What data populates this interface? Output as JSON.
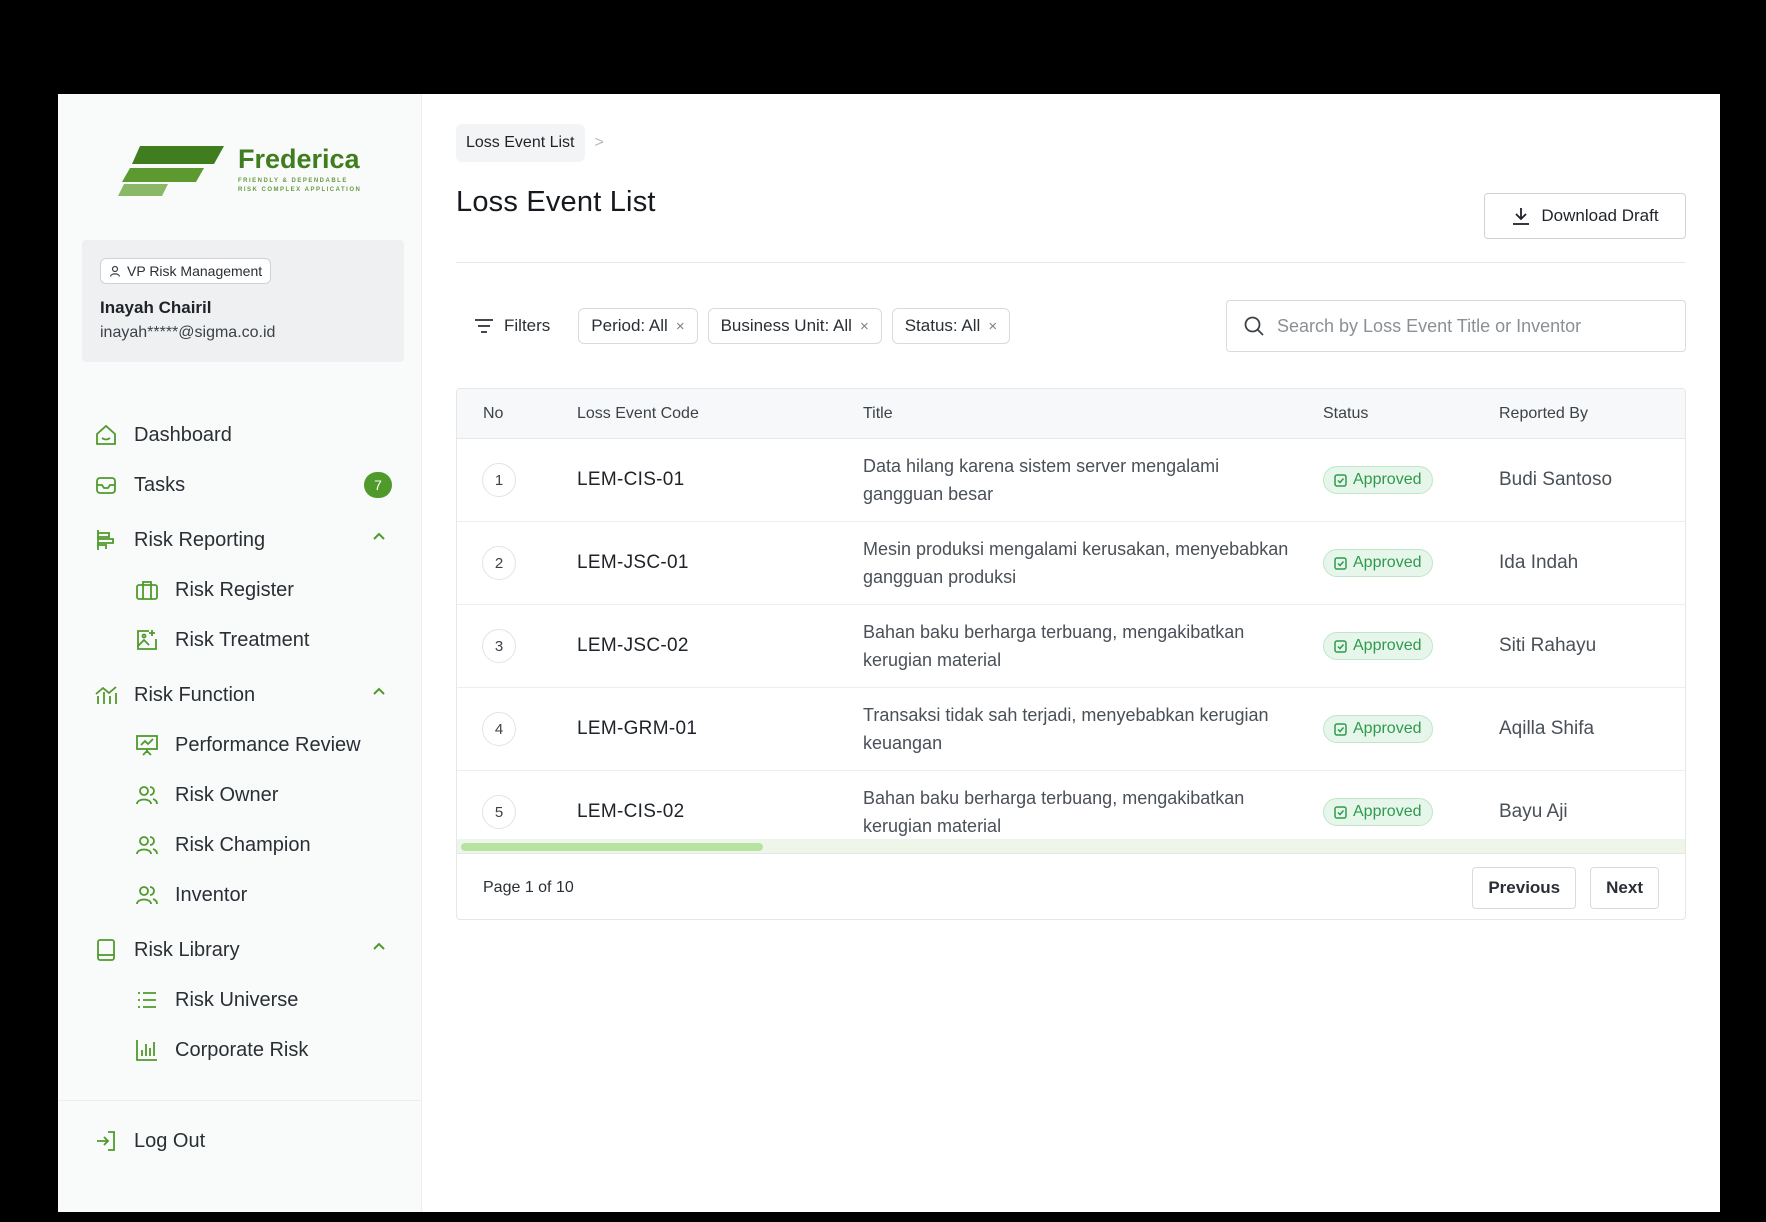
{
  "brand": {
    "name": "Frederica",
    "tagline_1": "FRIENDLY & DEPENDABLE",
    "tagline_2": "RISK COMPLEX APPLICATION",
    "accent": "#4f9a2b"
  },
  "user": {
    "role": "VP Risk Management",
    "name": "Inayah Chairil",
    "email": "inayah*****@sigma.co.id"
  },
  "sidebar": {
    "dashboard": "Dashboard",
    "tasks": "Tasks",
    "tasks_count": "7",
    "risk_reporting": "Risk Reporting",
    "risk_register": "Risk Register",
    "risk_treatment": "Risk Treatment",
    "risk_function": "Risk Function",
    "performance_review": "Performance Review",
    "risk_owner": "Risk Owner",
    "risk_champion": "Risk Champion",
    "inventor": "Inventor",
    "risk_library": "Risk Library",
    "risk_universe": "Risk Universe",
    "corporate_risk": "Corporate Risk",
    "logout": "Log Out"
  },
  "breadcrumb": {
    "current": "Loss Event List",
    "separator": ">"
  },
  "page": {
    "title": "Loss Event List",
    "download_label": "Download Draft"
  },
  "filters": {
    "label": "Filters",
    "chips": [
      "Period: All",
      "Business Unit: All",
      "Status: All"
    ],
    "remove": "×"
  },
  "search": {
    "placeholder": "Search by Loss Event Title or Inventor",
    "value": ""
  },
  "table": {
    "columns": [
      "No",
      "Loss Event Code",
      "Title",
      "Status",
      "Reported By"
    ],
    "rows": [
      {
        "no": "1",
        "code": "LEM-CIS-01",
        "title": "Data hilang karena sistem server mengalami gangguan besar",
        "status": "Approved",
        "reported_by": "Budi Santoso"
      },
      {
        "no": "2",
        "code": "LEM-JSC-01",
        "title": "Mesin produksi mengalami kerusakan, menyebabkan gangguan produksi",
        "status": "Approved",
        "reported_by": "Ida Indah"
      },
      {
        "no": "3",
        "code": "LEM-JSC-02",
        "title": "Bahan baku berharga terbuang, mengakibatkan kerugian material",
        "status": "Approved",
        "reported_by": "Siti Rahayu"
      },
      {
        "no": "4",
        "code": "LEM-GRM-01",
        "title": "Transaksi tidak sah terjadi, menyebabkan kerugian keuangan",
        "status": "Approved",
        "reported_by": "Aqilla Shifa"
      },
      {
        "no": "5",
        "code": "LEM-CIS-02",
        "title": "Bahan baku berharga terbuang, mengakibatkan kerugian material",
        "status": "Approved",
        "reported_by": "Bayu Aji"
      }
    ]
  },
  "pagination": {
    "info": "Page 1 of 10",
    "previous": "Previous",
    "next": "Next"
  }
}
